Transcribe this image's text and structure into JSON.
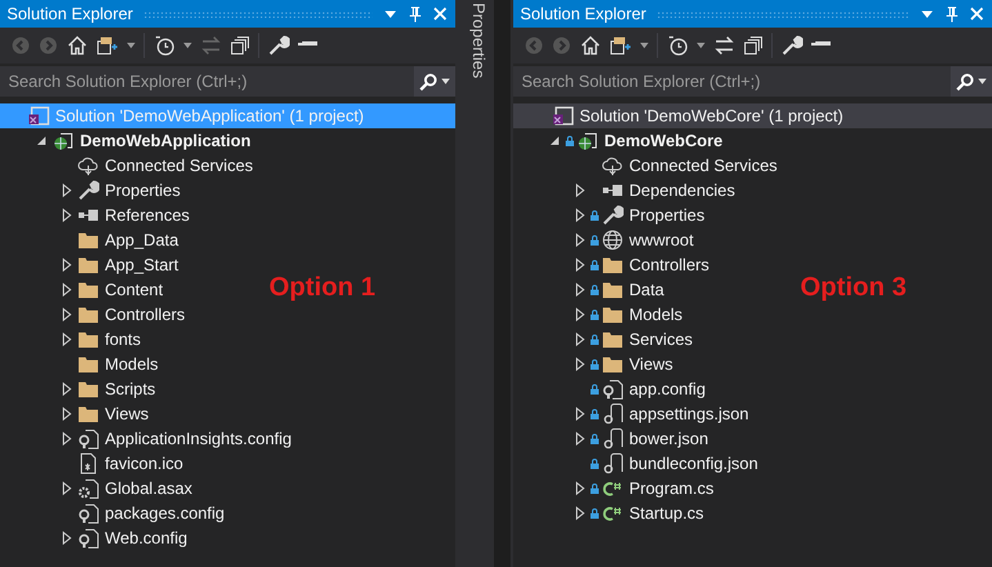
{
  "panels": [
    {
      "title": "Solution Explorer",
      "active": true,
      "search": {
        "placeholder": "Search Solution Explorer (Ctrl+;)"
      },
      "caption": "Option 1",
      "tree": [
        {
          "label": "Solution 'DemoWebApplication' (1 project)",
          "kind": "solution",
          "selected": true,
          "children": [
            {
              "label": "DemoWebApplication",
              "kind": "project",
              "expanded": true,
              "selected": false,
              "children": [
                {
                  "label": "Connected Services",
                  "kind": "service",
                  "selected": false
                },
                {
                  "label": "Properties",
                  "kind": "properties",
                  "expanded": false,
                  "selected": false
                },
                {
                  "label": "References",
                  "kind": "references",
                  "expanded": false,
                  "selected": false
                },
                {
                  "label": "App_Data",
                  "kind": "folder",
                  "selected": false
                },
                {
                  "label": "App_Start",
                  "kind": "folder",
                  "expanded": false,
                  "selected": false
                },
                {
                  "label": "Content",
                  "kind": "folder",
                  "expanded": false,
                  "selected": false
                },
                {
                  "label": "Controllers",
                  "kind": "folder",
                  "expanded": false,
                  "selected": false
                },
                {
                  "label": "fonts",
                  "kind": "folder",
                  "expanded": false,
                  "selected": false
                },
                {
                  "label": "Models",
                  "kind": "folder",
                  "selected": false
                },
                {
                  "label": "Scripts",
                  "kind": "folder",
                  "expanded": false,
                  "selected": false
                },
                {
                  "label": "Views",
                  "kind": "folder",
                  "expanded": false,
                  "selected": false
                },
                {
                  "label": "ApplicationInsights.config",
                  "kind": "config",
                  "expanded": false,
                  "selected": false
                },
                {
                  "label": "favicon.ico",
                  "kind": "image",
                  "selected": false
                },
                {
                  "label": "Global.asax",
                  "kind": "asax",
                  "expanded": false,
                  "selected": false
                },
                {
                  "label": "packages.config",
                  "kind": "config",
                  "selected": false
                },
                {
                  "label": "Web.config",
                  "kind": "config",
                  "expanded": false,
                  "selected": false
                }
              ]
            }
          ]
        }
      ]
    },
    {
      "title": "Solution Explorer",
      "active": false,
      "search": {
        "placeholder": "Search Solution Explorer (Ctrl+;)"
      },
      "caption": "Option 3",
      "tree": [
        {
          "label": "Solution 'DemoWebCore' (1 project)",
          "kind": "solution",
          "selected": true,
          "children": [
            {
              "label": "DemoWebCore",
              "kind": "project",
              "expanded": true,
              "locked": true,
              "selected": false,
              "children": [
                {
                  "label": "Connected Services",
                  "kind": "service",
                  "selected": false
                },
                {
                  "label": "Dependencies",
                  "kind": "references",
                  "expanded": false,
                  "selected": false
                },
                {
                  "label": "Properties",
                  "kind": "properties",
                  "expanded": false,
                  "locked": true,
                  "selected": false
                },
                {
                  "label": "wwwroot",
                  "kind": "globe",
                  "expanded": false,
                  "locked": true,
                  "selected": false
                },
                {
                  "label": "Controllers",
                  "kind": "folder",
                  "expanded": false,
                  "locked": true,
                  "selected": false
                },
                {
                  "label": "Data",
                  "kind": "folder",
                  "expanded": false,
                  "locked": true,
                  "selected": false
                },
                {
                  "label": "Models",
                  "kind": "folder",
                  "expanded": false,
                  "locked": true,
                  "selected": false
                },
                {
                  "label": "Services",
                  "kind": "folder",
                  "expanded": false,
                  "locked": true,
                  "selected": false
                },
                {
                  "label": "Views",
                  "kind": "folder",
                  "expanded": false,
                  "locked": true,
                  "selected": false
                },
                {
                  "label": "app.config",
                  "kind": "config",
                  "locked": true,
                  "selected": false
                },
                {
                  "label": "appsettings.json",
                  "kind": "json",
                  "expanded": false,
                  "locked": true,
                  "selected": false
                },
                {
                  "label": "bower.json",
                  "kind": "json",
                  "expanded": false,
                  "locked": true,
                  "selected": false
                },
                {
                  "label": "bundleconfig.json",
                  "kind": "json",
                  "locked": true,
                  "selected": false
                },
                {
                  "label": "Program.cs",
                  "kind": "csharp",
                  "expanded": false,
                  "locked": true,
                  "selected": false
                },
                {
                  "label": "Startup.cs",
                  "kind": "csharp",
                  "expanded": false,
                  "locked": true,
                  "selected": false
                }
              ]
            }
          ]
        }
      ]
    }
  ],
  "side_tab": {
    "label": "Properties"
  }
}
